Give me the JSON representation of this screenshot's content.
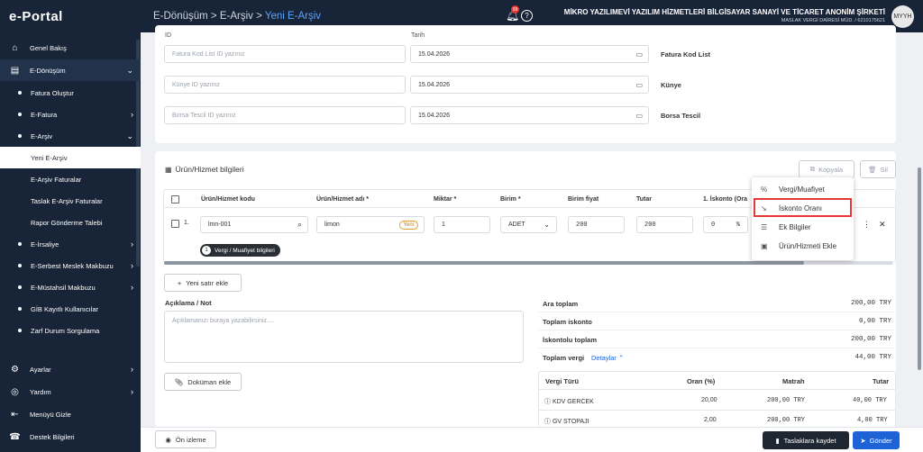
{
  "app": {
    "logo": "e-Portal"
  },
  "sidebar": {
    "items": [
      {
        "label": "Genel Bakış",
        "icon": "home-icon"
      },
      {
        "label": "E-Dönüşüm",
        "icon": "document-icon"
      },
      {
        "label": "Fatura Oluştur"
      },
      {
        "label": "E-Fatura"
      },
      {
        "label": "E-Arşiv"
      },
      {
        "label": "Yeni E-Arşiv"
      },
      {
        "label": "E-Arşiv Faturalar"
      },
      {
        "label": "Taslak E-Arşiv Faturalar"
      },
      {
        "label": "Rapor Gönderme Talebi"
      },
      {
        "label": "E-İrsaliye"
      },
      {
        "label": "E-Serbest Meslek Makbuzu"
      },
      {
        "label": "E-Müstahsil Makbuzu"
      },
      {
        "label": "GİB Kayıtlı Kullanıcılar"
      },
      {
        "label": "Zarf Durum Sorgulama"
      },
      {
        "label": "Ayarlar",
        "icon": "gear-icon"
      },
      {
        "label": "Yardım",
        "icon": "help-circle-icon"
      },
      {
        "label": "Menüyü Gizle",
        "icon": "collapse-icon"
      },
      {
        "label": "Destek Bilgileri",
        "icon": "support-icon"
      }
    ]
  },
  "topbar": {
    "breadcrumb": [
      "E-Dönüşüm",
      ">",
      "E-Arşiv",
      ">",
      "Yeni E-Arşiv"
    ],
    "notification_count": "99",
    "company_name": "MİKRO YAZILIMEVİ YAZILIM HİZMETLERİ BİLGİSAYAR SANAYİ VE TİCARET ANONİM ŞİRKETİ",
    "company_sub": "MASLAK VERGİ DAİRESİ MÜD. / 6210175621",
    "avatar": "MYYH"
  },
  "refs": {
    "id_label": "ID",
    "tarih_label": "Tarih",
    "rows": [
      {
        "placeholder": "Fatura Kod List ID yazınız",
        "date": "15.04.2026",
        "label": "Fatura Kod List"
      },
      {
        "placeholder": "Künye ID yazınız",
        "date": "15.04.2026",
        "label": "Künye"
      },
      {
        "placeholder": "Borsa Tescil  ID yazınız",
        "date": "15.04.2026",
        "label": "Borsa Tescil"
      }
    ]
  },
  "products": {
    "title": "Ürün/Hizmet bilgileri",
    "copy_label": "Kopyala",
    "delete_label": "Sil",
    "columns": [
      "Ürün/Hizmet kodu",
      "Ürün/Hizmet adı *",
      "Miktar *",
      "Birim *",
      "Birim fiyat",
      "Tutar",
      "1. İskonto (Ora"
    ],
    "row": {
      "index": "1.",
      "code": "lmn-001",
      "name": "limon",
      "name_tag": "Yeni",
      "qty": "1",
      "unit": "ADET",
      "price": "200",
      "total": "200",
      "discount": "0",
      "discount_unit": "%"
    },
    "tax_chip_count": "1",
    "tax_chip": "Vergi / Muafiyet bilgileri",
    "add_row": "Yeni satır ekle"
  },
  "context_menu": {
    "items": [
      {
        "label": "Vergi/Muafiyet",
        "icon": "percent-icon"
      },
      {
        "label": "İskonto Oranı",
        "icon": "trend-down-icon"
      },
      {
        "label": "Ek Bilgiler",
        "icon": "list-icon"
      },
      {
        "label": "Ürün/Hizmeti Ekle",
        "icon": "save-icon"
      }
    ]
  },
  "note": {
    "label": "Açıklama / Not",
    "placeholder": "Açıklamanızı buraya yazabilirsiniz....",
    "doc_button": "Doküman ekle"
  },
  "totals": {
    "rows": [
      {
        "label": "Ara toplam",
        "value": "200,00 TRY"
      },
      {
        "label": "Toplam iskonto",
        "value": "0,00 TRY"
      },
      {
        "label": "İskontolu toplam",
        "value": "200,00 TRY"
      },
      {
        "label": "Toplam vergi",
        "value": "44,00 TRY",
        "detail": "Detaylar"
      }
    ],
    "tax_table": {
      "headers": [
        "Vergi Türü",
        "Oran (%)",
        "Matrah",
        "Tutar"
      ],
      "rows": [
        {
          "type": "KDV GERCEK",
          "rate": "20,00",
          "base": "200,00 TRY",
          "amount": "40,00 TRY"
        },
        {
          "type": "GV STOPAJI",
          "rate": "2,00",
          "base": "200,00 TRY",
          "amount": "4,00 TRY"
        }
      ]
    }
  },
  "footer": {
    "preview": "Ön izleme",
    "draft": "Taslaklara kaydet",
    "send": "Gönder"
  },
  "colors": {
    "sidebar": "#182538",
    "accent": "#1e63d6",
    "highlight": "#e53935"
  }
}
